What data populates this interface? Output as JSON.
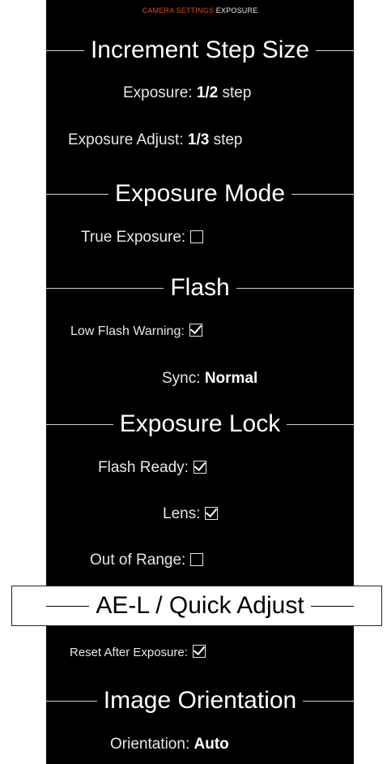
{
  "breadcrumb": {
    "category": "CAMERA SETTINGS:",
    "page": "EXPOSURE"
  },
  "sections": {
    "increment": "Increment Step Size",
    "mode": "Exposure Mode",
    "flash": "Flash",
    "lock": "Exposure Lock",
    "ael": "AE-L / Quick Adjust",
    "orientation": "Image Orientation"
  },
  "settings": {
    "exposure": {
      "label": "Exposure:",
      "value": "1/2",
      "unit": "step"
    },
    "exposure_adjust": {
      "label": "Exposure Adjust:",
      "value": "1/3",
      "unit": "step"
    },
    "true_exposure": {
      "label": "True Exposure:",
      "checked": false
    },
    "low_flash_warning": {
      "label": "Low Flash Warning:",
      "checked": true
    },
    "sync": {
      "label": "Sync:",
      "value": "Normal"
    },
    "flash_ready": {
      "label": "Flash Ready:",
      "checked": true
    },
    "lens": {
      "label": "Lens:",
      "checked": true
    },
    "out_of_range": {
      "label": "Out of Range:",
      "checked": false
    },
    "reset_after_exposure": {
      "label": "Reset After Exposure:",
      "checked": true
    },
    "orientation": {
      "label": "Orientation:",
      "value": "Auto"
    }
  },
  "colors": {
    "background": "#000000",
    "breadcrumb_accent": "#d64a2a",
    "text": "#e6e6e6"
  }
}
